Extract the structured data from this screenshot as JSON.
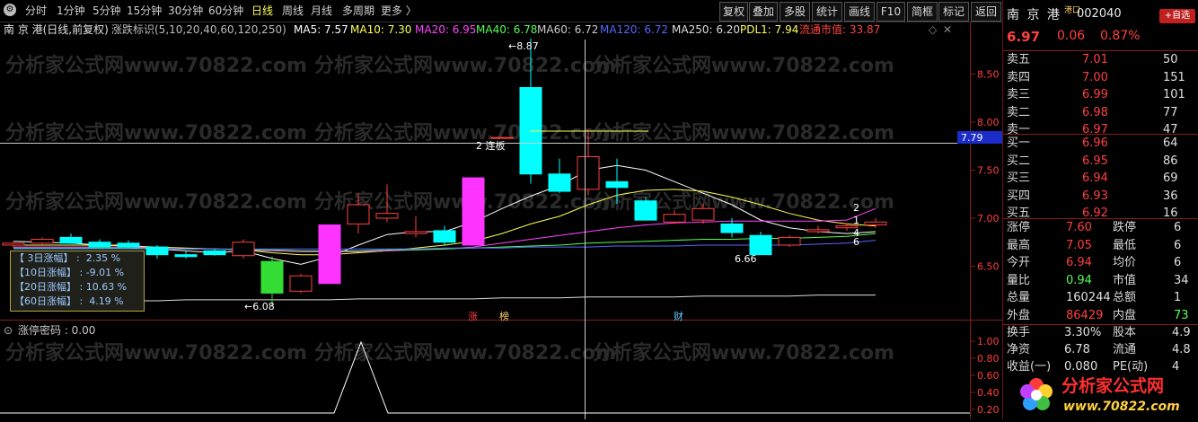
{
  "toolbar": {
    "periods": [
      "分时",
      "1分钟",
      "5分钟",
      "15分钟",
      "30分钟",
      "60分钟",
      "日线",
      "周线",
      "月线",
      "多周期",
      "更多 〉"
    ],
    "active_period": "日线",
    "right_buttons": [
      "复权",
      "叠加",
      "多股",
      "统计",
      "画线",
      "F10",
      "简框",
      "标记",
      "返回"
    ]
  },
  "chart_header": {
    "stock": "南 京 港(日线,前复权)",
    "indicator": "涨跌标识(5,10,20,40,60,120,250)",
    "ma5": "MA5: 7.57",
    "ma10": "MA10: 7.30",
    "ma20": "MA20: 6.95",
    "ma40": "MA40: 6.78",
    "ma60": "MA60: 6.72",
    "ma120": "MA120: 6.72",
    "ma250": "MA250: 6.20",
    "pdl1": "PDL1: 7.94",
    "mktcap": "流通市值: 33.87"
  },
  "sub_indicator": "涨停密码 : 0.00",
  "info_box": [
    "【 3日涨幅】 :  2.35 %",
    "【10日涨幅】 : -9.01 %",
    "【20日涨幅】 : 10.63 %",
    "【60日涨幅】 :  4.19 %"
  ],
  "markers": {
    "high": "8.87",
    "low": "6.08",
    "low2": "6.66",
    "limit": "2 连板",
    "crosshair_price": "7.79",
    "events": [
      "涨",
      "榜",
      "财"
    ],
    "line_labels": [
      "2",
      "1",
      "4",
      "6"
    ]
  },
  "watermark": "分析家公式网www.70822.com",
  "right_panel": {
    "name": "南 京 港",
    "tag": "港口",
    "code": "002040",
    "add_button": "+自选",
    "price": "6.97",
    "change": "0.06",
    "pct": "0.87%",
    "asks": [
      {
        "label": "卖五",
        "price": "7.01",
        "vol": "50"
      },
      {
        "label": "卖四",
        "price": "7.00",
        "vol": "151"
      },
      {
        "label": "卖三",
        "price": "6.99",
        "vol": "101"
      },
      {
        "label": "卖二",
        "price": "6.98",
        "vol": "77"
      },
      {
        "label": "卖一",
        "price": "6.97",
        "vol": "47"
      }
    ],
    "bids": [
      {
        "label": "买一",
        "price": "6.96",
        "vol": "64"
      },
      {
        "label": "买二",
        "price": "6.95",
        "vol": "86"
      },
      {
        "label": "买三",
        "price": "6.94",
        "vol": "69"
      },
      {
        "label": "买四",
        "price": "6.93",
        "vol": "36"
      },
      {
        "label": "买五",
        "price": "6.92",
        "vol": "16"
      }
    ],
    "stats": [
      {
        "l1": "涨停",
        "v1": "7.60",
        "l2": "跌停",
        "v2": "6"
      },
      {
        "l1": "最高",
        "v1": "7.05",
        "l2": "最低",
        "v2": "6"
      },
      {
        "l1": "今开",
        "v1": "6.94",
        "l2": "均价",
        "v2": "6"
      },
      {
        "l1": "量比",
        "v1": "0.94",
        "l2": "市值",
        "v2": "34"
      },
      {
        "l1": "总量",
        "v1": "160244",
        "l2": "总额",
        "v2": "1"
      },
      {
        "l1": "外盘",
        "v1": "86429",
        "l2": "内盘",
        "v2": "73"
      }
    ],
    "stats2": [
      {
        "l1": "换手",
        "v1": "3.30%",
        "l2": "股本",
        "v2": "4.9"
      },
      {
        "l1": "净资",
        "v1": "6.78",
        "l2": "流通",
        "v2": "4.8"
      },
      {
        "l1": "收益(一)",
        "v1": "0.080",
        "l2": "PE(动)",
        "v2": "4"
      }
    ],
    "logo_text": "分析家公式网",
    "logo_url": "www.70822.com"
  },
  "chart_data": {
    "type": "candlestick",
    "y_axis_ticks": [
      6.5,
      7.0,
      7.5,
      8.0,
      8.5
    ],
    "sub_axis_ticks": [
      1.0,
      0.8,
      0.6,
      0.4,
      0.2
    ],
    "candles": [
      {
        "o": 6.72,
        "h": 6.76,
        "l": 6.69,
        "c": 6.74
      },
      {
        "o": 6.74,
        "h": 6.8,
        "l": 6.71,
        "c": 6.78
      },
      {
        "o": 6.8,
        "h": 6.84,
        "l": 6.74,
        "c": 6.74
      },
      {
        "o": 6.75,
        "h": 6.78,
        "l": 6.7,
        "c": 6.7
      },
      {
        "o": 6.74,
        "h": 6.77,
        "l": 6.69,
        "c": 6.7
      },
      {
        "o": 6.7,
        "h": 6.72,
        "l": 6.58,
        "c": 6.62
      },
      {
        "o": 6.62,
        "h": 6.66,
        "l": 6.58,
        "c": 6.6
      },
      {
        "o": 6.66,
        "h": 6.68,
        "l": 6.61,
        "c": 6.62
      },
      {
        "o": 6.61,
        "h": 6.78,
        "l": 6.58,
        "c": 6.75
      },
      {
        "o": 6.55,
        "h": 6.6,
        "l": 6.08,
        "c": 6.22
      },
      {
        "o": 6.24,
        "h": 6.42,
        "l": 6.22,
        "c": 6.4
      },
      {
        "o": 6.32,
        "h": 6.93,
        "l": 6.32,
        "c": 6.93
      },
      {
        "o": 6.94,
        "h": 7.26,
        "l": 6.84,
        "c": 7.14
      },
      {
        "o": 7.0,
        "h": 7.35,
        "l": 6.96,
        "c": 7.05
      },
      {
        "o": 6.84,
        "h": 7.02,
        "l": 6.8,
        "c": 6.86
      },
      {
        "o": 6.87,
        "h": 6.92,
        "l": 6.72,
        "c": 6.75
      },
      {
        "o": 6.72,
        "h": 7.42,
        "l": 6.72,
        "c": 7.42
      },
      {
        "o": 7.84,
        "h": 7.84,
        "l": 7.84,
        "c": 7.84
      },
      {
        "o": 8.36,
        "h": 8.87,
        "l": 7.36,
        "c": 7.46
      },
      {
        "o": 7.46,
        "h": 7.62,
        "l": 7.26,
        "c": 7.28
      },
      {
        "o": 7.3,
        "h": 7.92,
        "l": 7.24,
        "c": 7.64
      },
      {
        "o": 7.38,
        "h": 7.62,
        "l": 7.15,
        "c": 7.32
      },
      {
        "o": 7.18,
        "h": 7.22,
        "l": 6.98,
        "c": 6.98
      },
      {
        "o": 6.96,
        "h": 7.08,
        "l": 6.94,
        "c": 7.04
      },
      {
        "o": 6.98,
        "h": 7.15,
        "l": 6.94,
        "c": 7.1
      },
      {
        "o": 6.94,
        "h": 7.0,
        "l": 6.8,
        "c": 6.85
      },
      {
        "o": 6.82,
        "h": 6.86,
        "l": 6.66,
        "c": 6.62
      },
      {
        "o": 6.72,
        "h": 6.82,
        "l": 6.7,
        "c": 6.8
      },
      {
        "o": 6.86,
        "h": 6.92,
        "l": 6.84,
        "c": 6.88
      },
      {
        "o": 6.9,
        "h": 6.95,
        "l": 6.87,
        "c": 6.92
      },
      {
        "o": 6.93,
        "h": 7.0,
        "l": 6.9,
        "c": 6.96
      }
    ]
  }
}
